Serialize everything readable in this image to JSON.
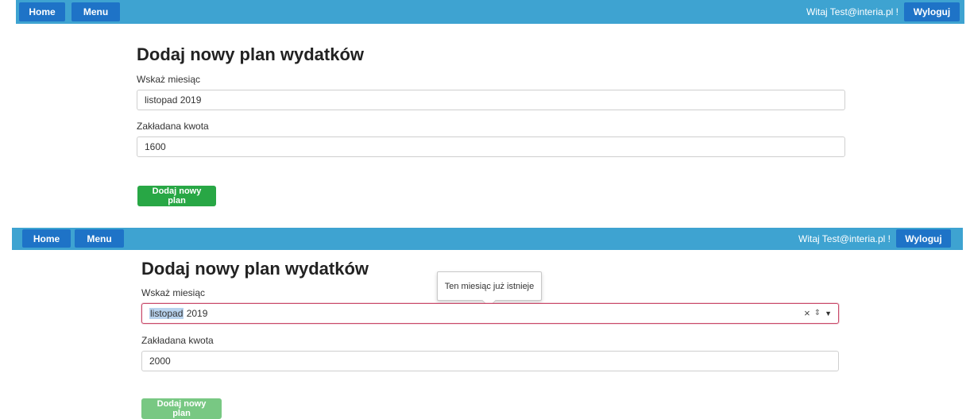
{
  "colors": {
    "navbar": "#3ea3d1",
    "nav_button": "#1e73c7",
    "submit_button": "#28a745",
    "submit_button_disabled": "#78c883",
    "error_border": "#c94a6a"
  },
  "nav": {
    "home_label": "Home",
    "menu_label": "Menu",
    "greeting": "Witaj Test@interia.pl !",
    "logout_label": "Wyloguj"
  },
  "form": {
    "title": "Dodaj nowy plan wydatków",
    "month_label": "Wskaż miesiąc",
    "amount_label": "Zakładana kwota",
    "submit_label": "Dodaj nowy plan"
  },
  "state1": {
    "month_value": "listopad 2019",
    "amount_value": "1600"
  },
  "state2": {
    "month_value_selected": "listopad",
    "month_value_rest": " 2019",
    "amount_value": "2000",
    "tooltip": "Ten miesiąc już istnieje",
    "clear_icon": "×",
    "spin_icon": "⇕",
    "dropdown_icon": "▼"
  }
}
